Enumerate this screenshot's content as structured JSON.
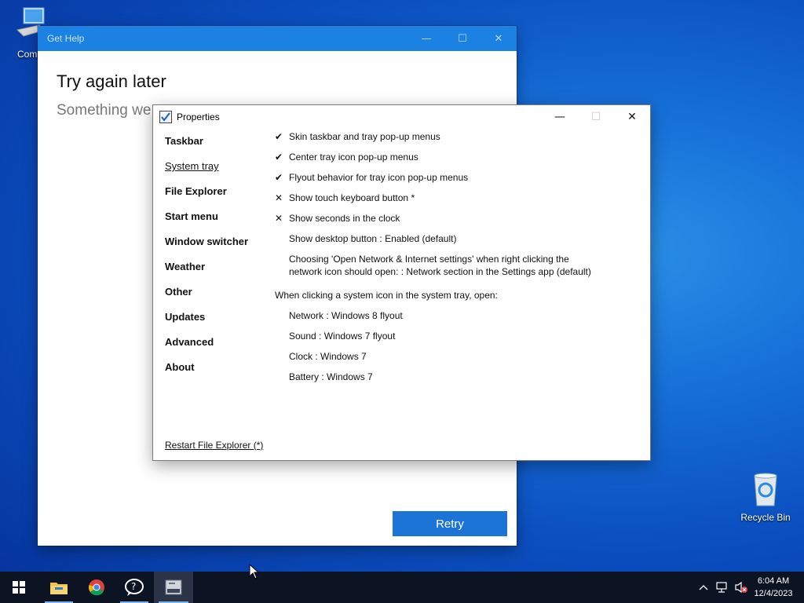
{
  "desktop": {
    "icons": [
      {
        "label": "Compr",
        "icon": "computer-icon"
      },
      {
        "label": "Recycle Bin",
        "icon": "recycle-bin-icon"
      }
    ]
  },
  "gethelp": {
    "title": "Get Help",
    "heading": "Try again later",
    "subtext": "Something we",
    "retry_label": "Retry"
  },
  "properties": {
    "title": "Properties",
    "nav": [
      {
        "label": "Taskbar"
      },
      {
        "label": "System tray",
        "active": true
      },
      {
        "label": "File Explorer"
      },
      {
        "label": "Start menu"
      },
      {
        "label": "Window switcher"
      },
      {
        "label": "Weather"
      },
      {
        "label": "Other"
      },
      {
        "label": "Updates"
      },
      {
        "label": "Advanced"
      },
      {
        "label": "About"
      }
    ],
    "settings": [
      {
        "mark": "✔",
        "text": "Skin taskbar and tray pop-up menus"
      },
      {
        "mark": "✔",
        "text": "Center tray icon pop-up menus"
      },
      {
        "mark": "✔",
        "text": "Flyout behavior for tray icon pop-up menus"
      },
      {
        "mark": "✕",
        "text": "Show touch keyboard button *"
      },
      {
        "mark": "✕",
        "text": "Show seconds in the clock"
      },
      {
        "mark": "",
        "text": "Show desktop button : Enabled (default)"
      },
      {
        "mark": "",
        "text": "Choosing 'Open Network & Internet settings' when right clicking the network icon should open: : Network section in the Settings app (default)"
      }
    ],
    "section_label": "When clicking a system icon in the system tray, open:",
    "flyouts": [
      {
        "text": "Network : Windows 8 flyout"
      },
      {
        "text": "Sound : Windows 7 flyout"
      },
      {
        "text": "Clock : Windows 7"
      },
      {
        "text": "Battery : Windows 7"
      }
    ],
    "restart_label": "Restart File Explorer (*)"
  },
  "taskbar": {
    "apps": [
      "start-icon",
      "file-explorer-icon",
      "chrome-icon",
      "get-help-icon",
      "properties-app-icon"
    ],
    "tray_icons": [
      "chevron-up-icon",
      "network-icon",
      "volume-muted-icon"
    ],
    "time": "6:04 AM",
    "date": "12/4/2023"
  }
}
